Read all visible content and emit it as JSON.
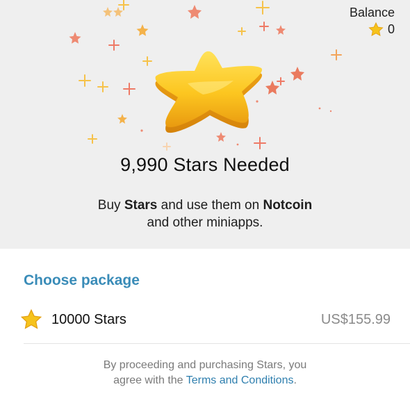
{
  "balance": {
    "label": "Balance",
    "value": "0",
    "icon": "star-icon"
  },
  "hero": {
    "headline": "9,990 Stars Needed",
    "desc_prefix": "Buy ",
    "desc_bold1": "Stars",
    "desc_mid": " and use them on ",
    "desc_bold2": "Notcoin",
    "desc_line2": "and other miniapps.",
    "icon": "big-star-icon"
  },
  "packages": {
    "title": "Choose package",
    "items": [
      {
        "name": "10000 Stars",
        "price": "US$155.99",
        "icon": "star-icon"
      }
    ]
  },
  "footer": {
    "line1": "By proceeding and purchasing Stars, you",
    "line2_prefix": "agree with the ",
    "link": "Terms and Conditions",
    "line2_suffix": "."
  },
  "colors": {
    "accent": "#3a8cb8",
    "link": "#2f7fae",
    "star_gold": "#f6c31c",
    "hero_bg": "#efefef"
  }
}
